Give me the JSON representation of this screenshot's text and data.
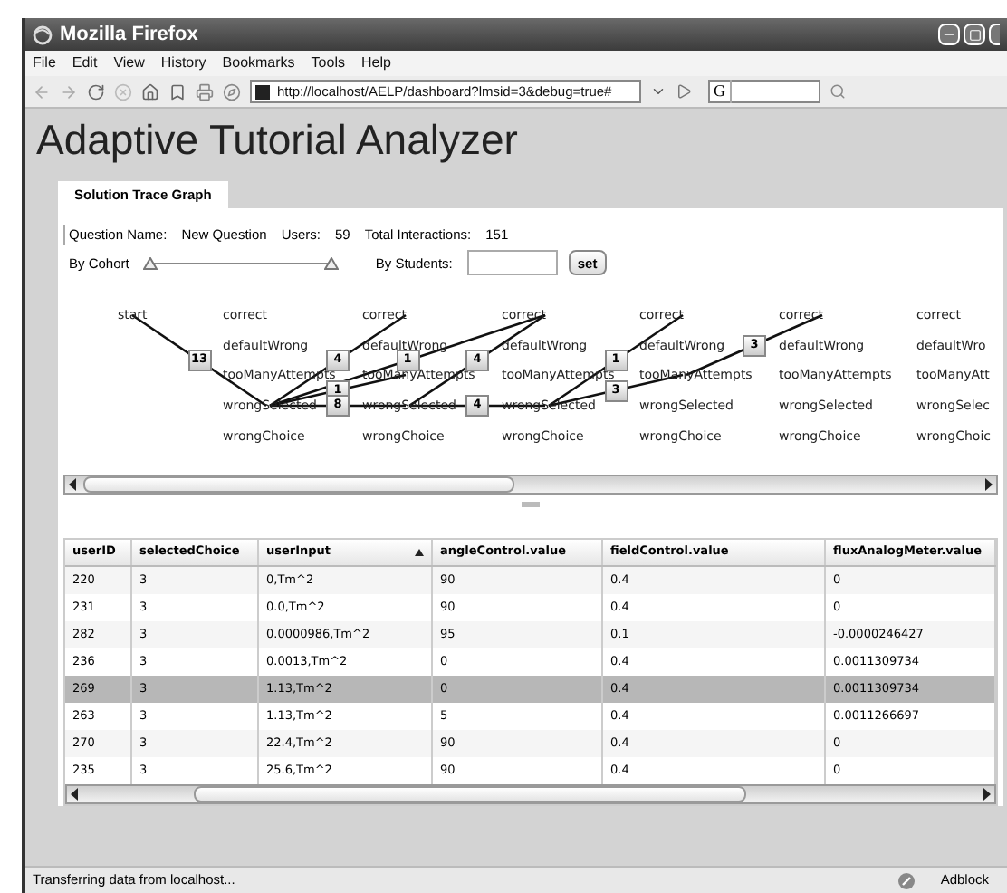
{
  "window": {
    "title": "Mozilla Firefox"
  },
  "menu": [
    "File",
    "Edit",
    "View",
    "History",
    "Bookmarks",
    "Tools",
    "Help"
  ],
  "address_bar": {
    "value": "http://localhost/AELP/dashboard?lmsid=3&debug=true#"
  },
  "search_engine": {
    "label": "G"
  },
  "page": {
    "title": "Adaptive Tutorial Analyzer",
    "tabs": [
      {
        "label": "Solution Trace Graph",
        "selected": true
      }
    ],
    "summary": [
      {
        "label": "Question Name:",
        "value": "New Question"
      },
      {
        "label": "Users:",
        "value": "59"
      },
      {
        "label": "Total Interactions:",
        "value": "151"
      }
    ],
    "cohort": {
      "label": "By Cohort",
      "thumbs": [
        {
          "level": 0
        },
        {
          "level": 1
        }
      ]
    },
    "students": {
      "label": "By Students:",
      "button": "set"
    },
    "graph": {
      "columns": [
        [
          "start"
        ],
        [
          "correct",
          "defaultWrong",
          "tooManyAttempts",
          "wrongSelected",
          "wrongChoice"
        ],
        [
          "correct",
          "defaultWrong",
          "tooManyAttempts",
          "wrongSelected",
          "wrongChoice"
        ],
        [
          "correct",
          "defaultWrong",
          "tooManyAttempts",
          "wrongSelected",
          "wrongChoice"
        ],
        [
          "correct",
          "defaultWrong",
          "tooManyAttempts",
          "wrongSelected",
          "wrongChoice"
        ],
        [
          "correct",
          "defaultWrong",
          "tooManyAttempts",
          "wrongSelected",
          "wrongChoice"
        ],
        [
          "correct",
          "defaultWro",
          "tooManyAtt",
          "wrongSelec",
          "wrongChoic"
        ]
      ],
      "edges": [
        {
          "count": "13"
        },
        {
          "count": "4"
        },
        {
          "count": "1"
        },
        {
          "count": "1"
        },
        {
          "count": "8"
        },
        {
          "count": "4"
        },
        {
          "count": "4"
        },
        {
          "count": "1"
        },
        {
          "count": "3"
        },
        {
          "count": "3"
        }
      ]
    },
    "table": {
      "columns": [
        {
          "label": "userID",
          "sorted": false
        },
        {
          "label": "selectedChoice",
          "sorted": false
        },
        {
          "label": "userInput",
          "sorted": true
        },
        {
          "label": "angleControl.value",
          "sorted": false
        },
        {
          "label": "fieldControl.value",
          "sorted": false
        },
        {
          "label": "fluxAnalogMeter.value",
          "sorted": false
        }
      ],
      "rows": [
        {
          "cells": [
            "220",
            "3",
            "0,Tm^2",
            "90",
            "0.4",
            "0"
          ],
          "selected": false
        },
        {
          "cells": [
            "231",
            "3",
            "0.0,Tm^2",
            "90",
            "0.4",
            "0"
          ],
          "selected": false
        },
        {
          "cells": [
            "282",
            "3",
            "0.0000986,Tm^2",
            "95",
            "0.1",
            "-0.0000246427"
          ],
          "selected": false
        },
        {
          "cells": [
            "236",
            "3",
            "0.0013,Tm^2",
            "0",
            "0.4",
            "0.0011309734"
          ],
          "selected": false
        },
        {
          "cells": [
            "269",
            "3",
            "1.13,Tm^2",
            "0",
            "0.4",
            "0.0011309734"
          ],
          "selected": true
        },
        {
          "cells": [
            "263",
            "3",
            "1.13,Tm^2",
            "5",
            "0.4",
            "0.0011266697"
          ],
          "selected": false
        },
        {
          "cells": [
            "270",
            "3",
            "22.4,Tm^2",
            "90",
            "0.4",
            "0"
          ],
          "selected": false
        },
        {
          "cells": [
            "235",
            "3",
            "25.6,Tm^2",
            "90",
            "0.4",
            "0"
          ],
          "selected": false
        }
      ]
    }
  },
  "status_bar": {
    "text": "Transferring data from localhost...",
    "addon": "Adblock"
  }
}
